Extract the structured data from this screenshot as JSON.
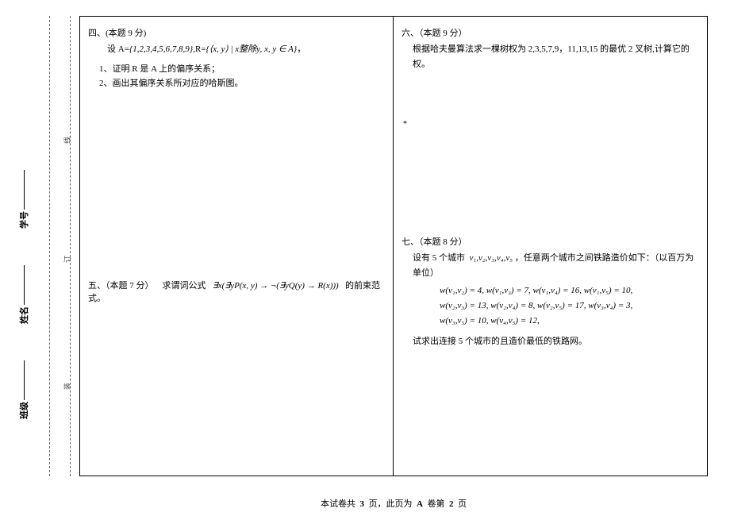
{
  "binding": {
    "label_class": "班级",
    "label_name": "姓名",
    "label_id": "学号",
    "seal1": "装",
    "seal2": "订",
    "seal3": "线"
  },
  "q4": {
    "header": "四、(本题 9 分)",
    "line1_pre": "设 A=",
    "line1_set": "{1,2,3,4,5,6,7,8,9}",
    "line1_mid": ",R=",
    "line1_rel": "{⟨x, y⟩ | x整除y, x, y ∈ A}",
    "line1_end": "，",
    "sub1": "1、证明 R 是 A 上的偏序关系；",
    "sub2": "2、画出其偏序关系所对应的哈斯图。"
  },
  "q5": {
    "header": "五、（本题 7 分）",
    "body_pre": "求谓词公式",
    "formula": "∃x(∃yP(x, y) → ¬(∃yQ(y) → R(x)))",
    "body_post": "的前束范式。"
  },
  "q6": {
    "header": "六、（本题 9 分）",
    "body": "根据哈夫曼算法求一棵树权为 2,3,5,7,9，11,13,15 的最优 2 叉树,计算它的权。",
    "star": "*"
  },
  "q7": {
    "header": "七、（本题 8 分）",
    "line1_pre": "设有 5 个城市",
    "cities": "v₁,v₂,v₃,v₄,v₅",
    "line1_post": "，任意两个城市之间铁路造价如下：（以百万为单位）",
    "w1": "w(v₁,v₂) = 4, w(v₁,v₃) = 7, w(v₁,v₄) = 16, w(v₁,v₅) = 10,",
    "w2": "w(v₂,v₃) = 13, w(v₂,v₄) = 8, w(v₂,v₅) = 17, w(v₃,v₄) = 3,",
    "w3": "w(v₃,v₅) = 10, w(v₄,v₅) = 12,",
    "line2": "试求出连接 5 个城市的且造价最低的铁路网。"
  },
  "footer": {
    "pre": "本试卷共",
    "total": "3",
    "mid1": "页，此页为",
    "type": "A",
    "mid2": "卷第",
    "page": "2",
    "end": "页"
  }
}
